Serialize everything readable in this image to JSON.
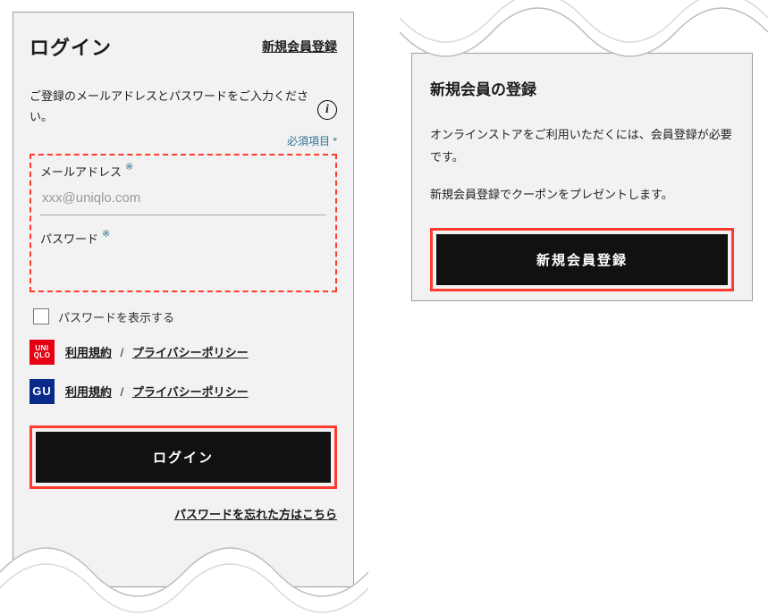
{
  "login": {
    "title": "ログイン",
    "signup_link": "新規会員登録",
    "instruction": "ご登録のメールアドレスとパスワードをご入力ください。",
    "required_note": "必須項目  *",
    "email_label": "メールアドレス",
    "email_placeholder": "xxx@uniqlo.com",
    "password_label": "パスワード",
    "show_password_label": "パスワードを表示する",
    "terms": {
      "uniqlo_logo": "UNI\nQLO",
      "gu_logo": "GU",
      "terms_text": "利用規約",
      "privacy_text": "プライバシーポリシー",
      "separator": "/"
    },
    "submit": "ログイン",
    "forgot": "パスワードを忘れた方はこちら"
  },
  "signup": {
    "title": "新規会員の登録",
    "body_line1": "オンラインストアをご利用いただくには、会員登録が必要です。",
    "body_line2": "新規会員登録でクーポンをプレゼントします。",
    "submit": "新規会員登録"
  },
  "icons": {
    "info": "i",
    "required": "※"
  }
}
